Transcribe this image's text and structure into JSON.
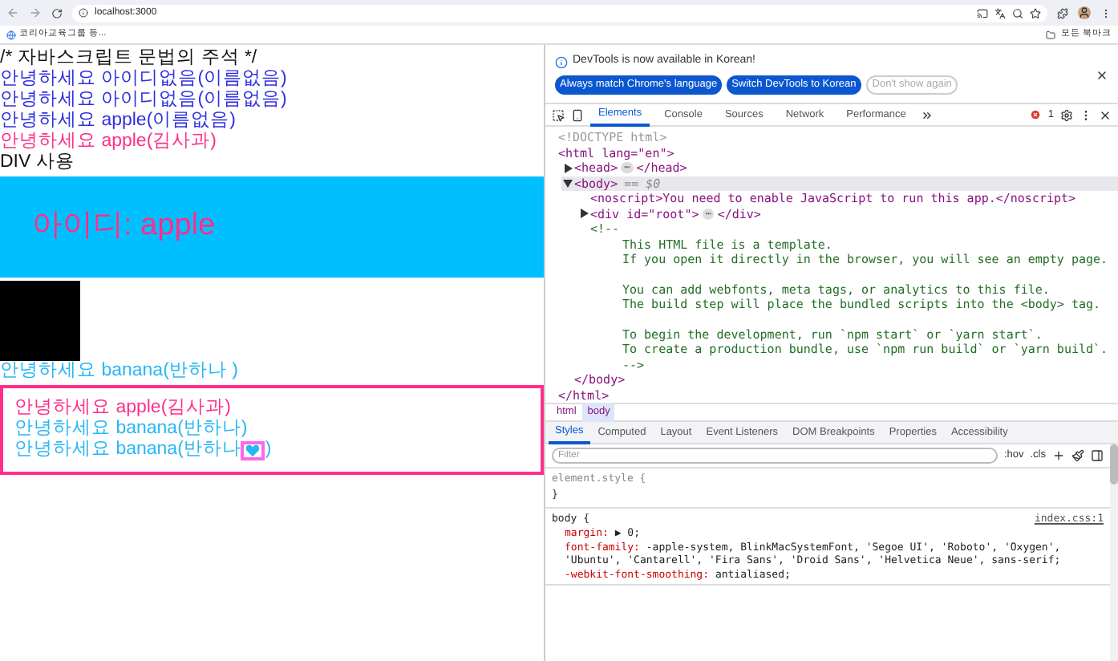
{
  "browser": {
    "address": "localhost:3000",
    "bookmarks": [
      {
        "label": "코리아교육그룹 등..."
      }
    ],
    "all_bookmarks": "모든 북마크"
  },
  "page": {
    "lines": [
      {
        "text": "/* 자바스크립트 문법의 주석 */",
        "color": "#111111"
      },
      {
        "text": "안녕하세요 아이디없음(이름없음)",
        "color": "#2f2fe0"
      },
      {
        "text": "안녕하세요 아이디없음(이름없음)",
        "color": "#2f2fe0"
      },
      {
        "text": "안녕하세요 apple(이름없음)",
        "color": "#2f2fe0"
      },
      {
        "text": "안녕하세요 apple(김사과)",
        "color": "#ff2e8a"
      },
      {
        "text": "DIV 사용",
        "color": "#111111"
      }
    ],
    "banner": {
      "text": "아이디: apple"
    },
    "after_line": {
      "text": "안녕하세요 banana(반하나 )",
      "color": "#29b6f6"
    },
    "box_lines": [
      {
        "kind": "text",
        "text": "안녕하세요 apple(김사과)",
        "color": "#ff2e8a"
      },
      {
        "kind": "text",
        "text": "안녕하세요 banana(반하나)",
        "color": "#29b6f6"
      },
      {
        "kind": "heart",
        "text": "안녕하세요 banana(반하나",
        "after": ")",
        "color": "#29b6f6"
      }
    ]
  },
  "devtools": {
    "notice": {
      "text": "DevTools is now available in Korean!",
      "buttons": [
        {
          "label": "Always match Chrome's language",
          "kind": "primary"
        },
        {
          "label": "Switch DevTools to Korean",
          "kind": "primary"
        },
        {
          "label": "Don't show again",
          "kind": "outline"
        }
      ]
    },
    "tabs": [
      {
        "label": "Elements",
        "selected": true
      },
      {
        "label": "Console",
        "selected": false
      },
      {
        "label": "Sources",
        "selected": false
      },
      {
        "label": "Network",
        "selected": false
      },
      {
        "label": "Performance",
        "selected": false
      }
    ],
    "error_count": "1",
    "tree": [
      {
        "kind": "doctype",
        "text": "<!DOCTYPE html>",
        "selected": false
      },
      {
        "kind": "tag",
        "text": "<html lang=\"en\">",
        "selected": false,
        "children": [
          {
            "kind": "tag",
            "expanded": false,
            "text": "<head>",
            "badge": "⋯",
            "end": "</head>",
            "selected": false
          },
          {
            "kind": "tag",
            "expanded": true,
            "text": "<body>",
            "suffix": "== $0",
            "selected": true,
            "children": [
              {
                "kind": "tag",
                "text": "<noscript>You need to enable JavaScript to run this app.</noscript>",
                "selected": false
              },
              {
                "kind": "tag",
                "expanded": false,
                "text": "<div id=\"root\">",
                "badge": "⋯",
                "end": "</div>",
                "selected": false
              },
              {
                "kind": "comment",
                "text": "<!--",
                "selected": false,
                "children": [
                  {
                    "kind": "comment",
                    "text": "This HTML file is a template.",
                    "selected": false
                  },
                  {
                    "kind": "comment",
                    "text": "If you open it directly in the browser, you will see an empty page.",
                    "selected": false
                  },
                  {
                    "kind": "comment",
                    "text": "You can add webfonts, meta tags, or analytics to this file.",
                    "gap": true,
                    "selected": false
                  },
                  {
                    "kind": "comment",
                    "text": "The build step will place the bundled scripts into the <body> tag.",
                    "selected": false
                  },
                  {
                    "kind": "comment",
                    "text": "To begin the development, run `npm start` or `yarn start`.",
                    "gap": true,
                    "selected": false
                  },
                  {
                    "kind": "comment",
                    "text": "To create a production bundle, use `npm run build` or `yarn build`.",
                    "selected": false
                  },
                  {
                    "kind": "comment",
                    "text": "-->",
                    "selected": false
                  }
                ]
              }
            ]
          },
          {
            "kind": "tag",
            "text": "</body>",
            "selected": false
          }
        ]
      },
      {
        "kind": "tag",
        "text": "</html>",
        "selected": false
      }
    ],
    "breadcrumbs": [
      {
        "label": "html",
        "selected": false
      },
      {
        "label": "body",
        "selected": true
      }
    ],
    "style_tabs": [
      {
        "label": "Styles",
        "selected": true
      },
      {
        "label": "Computed",
        "selected": false
      },
      {
        "label": "Layout",
        "selected": false
      },
      {
        "label": "Event Listeners",
        "selected": false
      },
      {
        "label": "DOM Breakpoints",
        "selected": false
      },
      {
        "label": "Properties",
        "selected": false
      },
      {
        "label": "Accessibility",
        "selected": false
      }
    ],
    "filter": {
      "placeholder": "Filter"
    },
    "hov": ":hov",
    "cls": ".cls",
    "rules": [
      {
        "selector": "element.style {",
        "close": "}"
      },
      {
        "selector": "body {",
        "source": "index.css:1",
        "properties": [
          {
            "name": "margin:",
            "value": "▶ 0;"
          },
          {
            "name": "font-family:",
            "value": "-apple-system, BlinkMacSystemFont, 'Segoe UI', 'Roboto', 'Oxygen', 'Ubuntu', 'Cantarell', 'Fira Sans', 'Droid Sans', 'Helvetica Neue', sans-serif;"
          },
          {
            "name": "-webkit-font-smoothing:",
            "value": "antialiased;"
          }
        ]
      }
    ]
  }
}
